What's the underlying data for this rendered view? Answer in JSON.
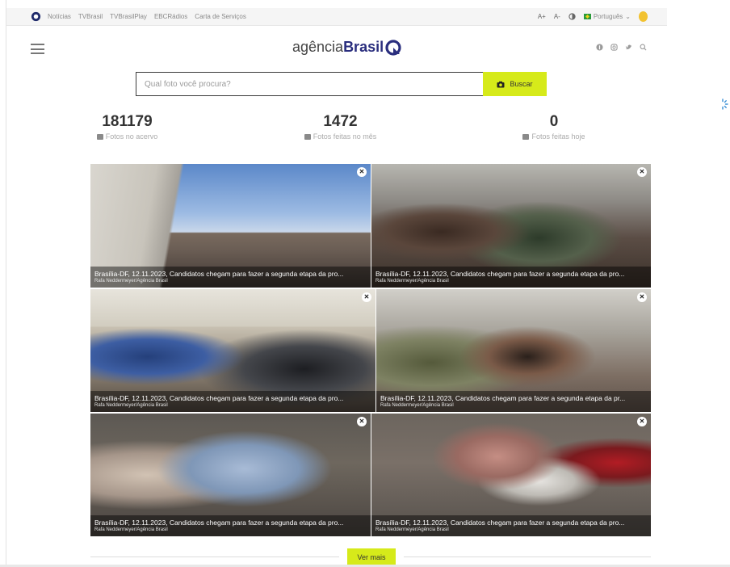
{
  "topbar": {
    "links": [
      "Notícias",
      "TVBrasil",
      "TVBrasilPlay",
      "EBCRádios",
      "Carta de Serviços"
    ],
    "font_increase": "A+",
    "font_decrease": "A-",
    "contrast_icon": "contrast-icon",
    "language": "Português",
    "language_caret": "⌄"
  },
  "header": {
    "brand_light": "agência",
    "brand_bold": "Brasil",
    "social_icons": [
      "facebook-icon",
      "instagram-icon",
      "twitter-icon",
      "search-icon"
    ]
  },
  "search": {
    "placeholder": "Qual foto você procura?",
    "button_label": "Buscar"
  },
  "stats": [
    {
      "value": "181179",
      "label": "Fotos no acervo"
    },
    {
      "value": "1472",
      "label": "Fotos feitas no mês"
    },
    {
      "value": "0",
      "label": "Fotos feitas hoje"
    }
  ],
  "photos": [
    {
      "caption": "Brasília-DF, 12.11.2023, Candidatos chegam para fazer a segunda etapa da pro...",
      "credit": "Rafa Neddermeyer/Agência Brasil"
    },
    {
      "caption": "Brasília-DF, 12.11.2023, Candidatos chegam para fazer a segunda etapa da pro...",
      "credit": "Rafa Neddermeyer/Agência Brasil"
    },
    {
      "caption": "Brasília-DF, 12.11.2023, Candidatos chegam para fazer a segunda etapa da pro...",
      "credit": "Rafa Neddermeyer/Agência Brasil"
    },
    {
      "caption": "Brasília-DF, 12.11.2023, Candidatos chegam para fazer a segunda etapa da pr...",
      "credit": "Rafa Neddermeyer/Agência Brasil"
    },
    {
      "caption": "Brasília-DF, 12.11.2023, Candidatos chegam para fazer a segunda etapa da pro...",
      "credit": "Rafa Neddermeyer/Agência Brasil"
    },
    {
      "caption": "Brasília-DF, 12.11.2023, Candidatos chegam para fazer a segunda etapa da pro...",
      "credit": "Rafa Neddermeyer/Agência Brasil"
    }
  ],
  "expand_glyph": "✕",
  "more": {
    "label": "Ver mais"
  },
  "colors": {
    "accent": "#d6ea1a",
    "brand": "#2a2e7e"
  }
}
